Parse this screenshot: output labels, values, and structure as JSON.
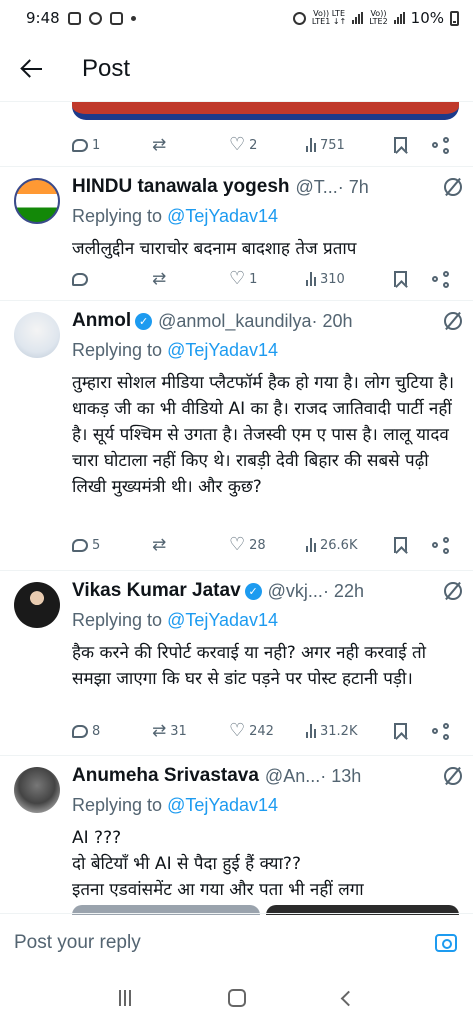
{
  "status_bar": {
    "time": "9:48",
    "network1": "Vo)) LTE\nLTE1 ↓↑",
    "network2": "Vo))\nLTE2",
    "battery": "10%"
  },
  "header": {
    "title": "Post"
  },
  "top_post_actions": {
    "replies": "1",
    "reposts": "",
    "likes": "2",
    "views": "751"
  },
  "replies": [
    {
      "name": "HINDU tanawala yogesh",
      "verified": false,
      "handle": "@T...",
      "time": " · 7h",
      "replying_prefix": "Replying to ",
      "replying_to": "@TejYadav14",
      "text": "जलीलुद्दीन चाराचोर बदनाम बादशाह तेज प्रताप",
      "actions": {
        "replies": "",
        "reposts": "",
        "likes": "1",
        "views": "310"
      }
    },
    {
      "name": "Anmol",
      "verified": true,
      "handle": "@anmol_kaundilya",
      "time": " · 20h",
      "replying_prefix": "Replying to ",
      "replying_to": "@TejYadav14",
      "text": "तुम्हारा सोशल मीडिया प्लैटफॉर्म हैक हो गया है। लोग चुटिया है। धाकड़ जी का भी वीडियो AI का है। राजद जातिवादी पार्टी नहीं है। सूर्य पश्चिम से उगता है। तेजस्वी एम ए पास है। लालू यादव चारा घोटाला नहीं किए थे। राबड़ी देवी बिहार की सबसे पढ़ी लिखी मुख्यमंत्री थी। और कुछ?",
      "actions": {
        "replies": "5",
        "reposts": "",
        "likes": "28",
        "views": "26.6K"
      }
    },
    {
      "name": "Vikas Kumar Jatav",
      "verified": true,
      "handle": "@vkj...",
      "time": " · 22h",
      "replying_prefix": "Replying to ",
      "replying_to": "@TejYadav14",
      "text": "हैक करने की रिपोर्ट करवाई या नही? अगर नही करवाई तो समझा जाएगा कि घर से डांट पड़ने पर पोस्ट हटानी पड़ी।",
      "actions": {
        "replies": "8",
        "reposts": "31",
        "likes": "242",
        "views": "31.2K"
      }
    },
    {
      "name": "Anumeha Srivastava",
      "verified": false,
      "handle": "@An...",
      "time": " · 13h",
      "replying_prefix": "Replying to ",
      "replying_to": "@TejYadav14",
      "text": "AI ???\nदो बेटियाँ भी AI से पैदा हुई हैं क्या??\nइतना एडवांसमेंट आ गया और पता भी नहीं लगा"
    }
  ],
  "compose": {
    "placeholder": "Post your reply"
  },
  "colors": {
    "accent": "#1d9bf0",
    "text": "#0f1419",
    "muted": "#536471",
    "divider": "#eff3f4"
  },
  "icons": [
    "back-arrow-icon",
    "reply-icon",
    "repost-icon",
    "like-icon",
    "views-icon",
    "bookmark-icon",
    "share-icon",
    "grok-icon",
    "verified-icon",
    "camera-icon"
  ]
}
